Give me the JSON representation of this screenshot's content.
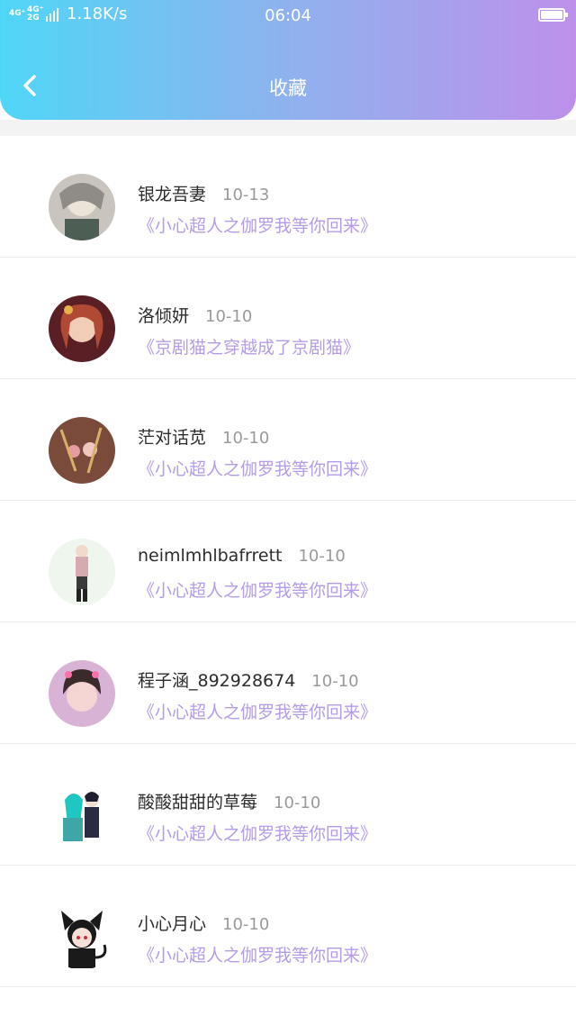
{
  "status_bar": {
    "network_1": "4G⁺",
    "network_2": "4G⁺ 2G",
    "speed": "1.18K/s",
    "time": "06:04"
  },
  "header": {
    "title": "收藏",
    "back_icon": "chevron-left-icon"
  },
  "colors": {
    "gradient_start": "#4fd6f7",
    "gradient_end": "#bd90ea",
    "work_title": "#b59ce8",
    "date": "#9a9a9a"
  },
  "favorites": [
    {
      "name": "银龙吾妻",
      "date": "10-13",
      "work": "《小心超人之伽罗我等你回来》"
    },
    {
      "name": "洛倾妍",
      "date": "10-10",
      "work": "《京剧猫之穿越成了京剧猫》"
    },
    {
      "name": "茫对话苋",
      "date": "10-10",
      "work": "《小心超人之伽罗我等你回来》"
    },
    {
      "name": "neimlmhlbafrrett",
      "date": "10-10",
      "work": "《小心超人之伽罗我等你回来》"
    },
    {
      "name": "程子涵_892928674",
      "date": "10-10",
      "work": "《小心超人之伽罗我等你回来》"
    },
    {
      "name": "酸酸甜甜的草莓",
      "date": "10-10",
      "work": "《小心超人之伽罗我等你回来》"
    },
    {
      "name": "小心月心",
      "date": "10-10",
      "work": "《小心超人之伽罗我等你回来》"
    }
  ]
}
